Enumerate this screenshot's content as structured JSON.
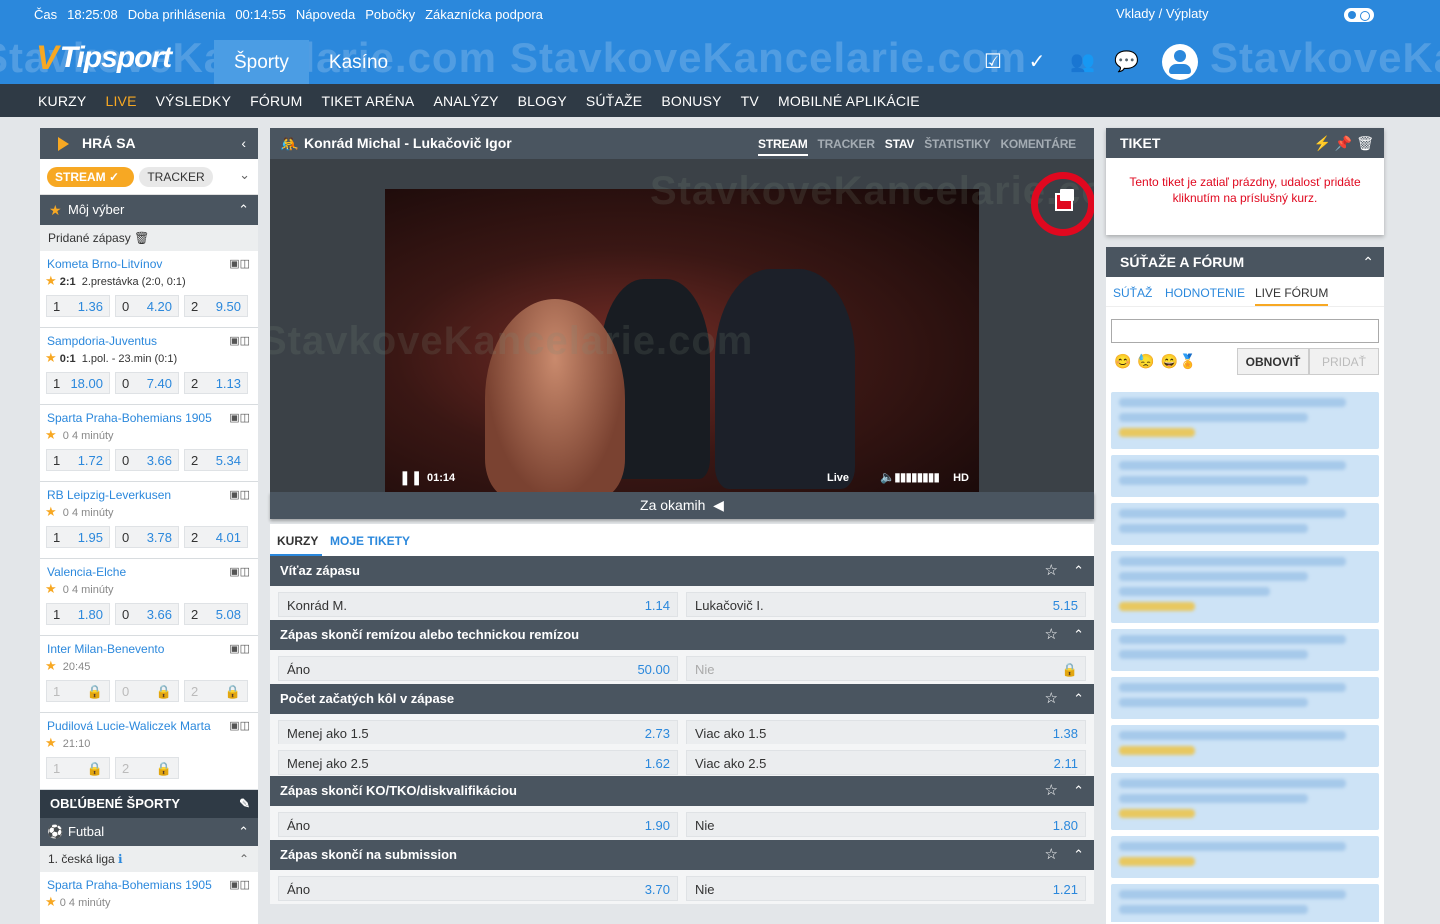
{
  "infobar": {
    "time_label": "Čas",
    "time": "18:25:08",
    "login_label": "Doba prihlásenia",
    "login": "00:14:55",
    "help": "Nápoveda",
    "branches": "Pobočky",
    "support": "Zákaznícka podpora",
    "deposits": "Vklady / Výplaty"
  },
  "logo": "Tipsport",
  "watermark": "StavkoveKancelarie.com",
  "mainnav": [
    "Športy",
    "Kasíno"
  ],
  "subnav": [
    "KURZY",
    "LIVE",
    "VÝSLEDKY",
    "FÓRUM",
    "TIKET ARÉNA",
    "ANALÝZY",
    "BLOGY",
    "SÚŤAŽE",
    "BONUSY",
    "TV",
    "MOBILNÉ APLIKÁCIE"
  ],
  "left": {
    "hra_sa": "HRÁ SA",
    "stream": "STREAM ✓",
    "tracker": "TRACKER",
    "moj_vyber": "Môj výber",
    "pridane": "Pridané zápasy",
    "matches": [
      {
        "name": "Kometa Brno-Litvínov",
        "score": "2:1",
        "info": "2.prestávka (2:0, 0:1)",
        "odds": [
          [
            "1",
            "1.36"
          ],
          [
            "0",
            "4.20"
          ],
          [
            "2",
            "9.50"
          ]
        ]
      },
      {
        "name": "Sampdoria-Juventus",
        "score": "0:1",
        "info": "1.pol. - 23.min (0:1)",
        "odds": [
          [
            "1",
            "18.00"
          ],
          [
            "0",
            "7.40"
          ],
          [
            "2",
            "1.13"
          ]
        ]
      },
      {
        "name": "Sparta Praha-Bohemians 1905",
        "score": "",
        "info": "0 4 minúty",
        "odds": [
          [
            "1",
            "1.72"
          ],
          [
            "0",
            "3.66"
          ],
          [
            "2",
            "5.34"
          ]
        ]
      },
      {
        "name": "RB Leipzig-Leverkusen",
        "score": "",
        "info": "0 4 minúty",
        "odds": [
          [
            "1",
            "1.95"
          ],
          [
            "0",
            "3.78"
          ],
          [
            "2",
            "4.01"
          ]
        ]
      },
      {
        "name": "Valencia-Elche",
        "score": "",
        "info": "0 4 minúty",
        "odds": [
          [
            "1",
            "1.80"
          ],
          [
            "0",
            "3.66"
          ],
          [
            "2",
            "5.08"
          ]
        ]
      },
      {
        "name": "Inter Milan-Benevento",
        "score": "",
        "info": "20:45",
        "odds": [
          [
            "1",
            "🔒"
          ],
          [
            "0",
            "🔒"
          ],
          [
            "2",
            "🔒"
          ]
        ]
      },
      {
        "name": "Pudilová Lucie-Waliczek Marta",
        "score": "",
        "info": "21:10",
        "odds": [
          [
            "1",
            "🔒"
          ],
          [
            "2",
            "🔒"
          ]
        ]
      }
    ],
    "oblubene": "OBĽÚBENÉ ŠPORTY",
    "futbal": "Futbal",
    "liga": "1. česká liga",
    "last_match": "Sparta Praha-Bohemians 1905",
    "last_info": "0 4 minúty"
  },
  "video": {
    "title": "Konrád Michal - Lukačovič Igor",
    "tabs": [
      "STREAM",
      "TRACKER",
      "STAV",
      "ŠTATISTIKY",
      "KOMENTÁRE"
    ],
    "time": "01:14",
    "live": "Live",
    "hd": "HD",
    "za_okamih": "Za okamih"
  },
  "bet_tabs": [
    "KURZY",
    "MOJE TIKETY"
  ],
  "markets": [
    {
      "title": "Víťaz zápasu",
      "rows": [
        [
          [
            "Konrád M.",
            "1.14"
          ],
          [
            "Lukačovič I.",
            "5.15"
          ]
        ]
      ]
    },
    {
      "title": "Zápas skončí remízou alebo technickou remízou",
      "rows": [
        [
          [
            "Áno",
            "50.00"
          ],
          [
            "Nie",
            "🔒"
          ]
        ]
      ]
    },
    {
      "title": "Počet začatých kôl v zápase",
      "rows": [
        [
          [
            "Menej ako 1.5",
            "2.73"
          ],
          [
            "Viac ako 1.5",
            "1.38"
          ]
        ],
        [
          [
            "Menej ako 2.5",
            "1.62"
          ],
          [
            "Viac ako 2.5",
            "2.11"
          ]
        ]
      ]
    },
    {
      "title": "Zápas skončí KO/TKO/diskvalifikáciou",
      "rows": [
        [
          [
            "Áno",
            "1.90"
          ],
          [
            "Nie",
            "1.80"
          ]
        ]
      ]
    },
    {
      "title": "Zápas skončí na submission",
      "rows": [
        [
          [
            "Áno",
            "3.70"
          ],
          [
            "Nie",
            "1.21"
          ]
        ]
      ]
    }
  ],
  "tiket": {
    "title": "TIKET",
    "msg": "Tento tiket je zatiaľ prázdny, udalosť pridáte kliknutím na príslušný kurz."
  },
  "sutaze": {
    "title": "SÚŤAŽE A FÓRUM",
    "tabs": [
      "SÚŤAŽ",
      "HODNOTENIE",
      "LIVE FÓRUM"
    ],
    "obnovit": "OBNOVIŤ",
    "pridat": "PRIDAŤ",
    "emoji": "😊 😓 😄🏅"
  }
}
